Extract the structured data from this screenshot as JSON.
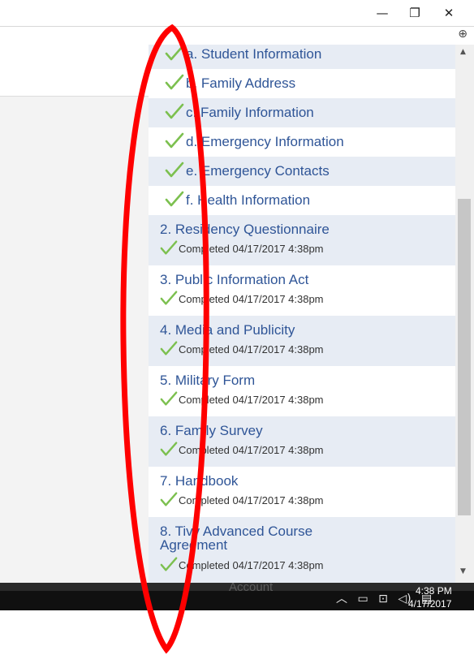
{
  "window": {
    "minimize_glyph": "—",
    "restore_glyph": "❐",
    "close_glyph": "✕",
    "zoom_icon": "zoom-in-icon"
  },
  "sub_items": [
    {
      "label": "a. Student Information"
    },
    {
      "label": "b. Family Address"
    },
    {
      "label": "c. Family Information"
    },
    {
      "label": "d. Emergency Information"
    },
    {
      "label": "e. Emergency Contacts"
    },
    {
      "label": "f. Health Information"
    }
  ],
  "steps": [
    {
      "title": "2. Residency Questionnaire",
      "status": "Completed 04/17/2017 4:38pm"
    },
    {
      "title": "3. Public Information Act",
      "status": "Completed 04/17/2017 4:38pm"
    },
    {
      "title": "4. Media and Publicity",
      "status": "Completed 04/17/2017 4:38pm"
    },
    {
      "title": "5. Military Form",
      "status": "Completed 04/17/2017 4:38pm"
    },
    {
      "title": "6. Family Survey",
      "status": "Completed 04/17/2017 4:38pm"
    },
    {
      "title": "7. Handbook",
      "status": "Completed 04/17/2017 4:38pm"
    },
    {
      "title": "8. Tivy Advanced Course",
      "title_line2": "Agreement",
      "status": "Completed 04/17/2017 4:38pm"
    }
  ],
  "taskbar": {
    "account_label": "Account",
    "tray_icons": [
      "chevron-up-icon",
      "battery-icon",
      "network-icon",
      "volume-icon",
      "notification-icon"
    ],
    "time": "4:38 PM",
    "date": "4/17/2017"
  },
  "colors": {
    "link": "#2f5597",
    "row_alt": "#e7ecf4",
    "check_green": "#7cc04f",
    "annotation": "#ff0000"
  }
}
